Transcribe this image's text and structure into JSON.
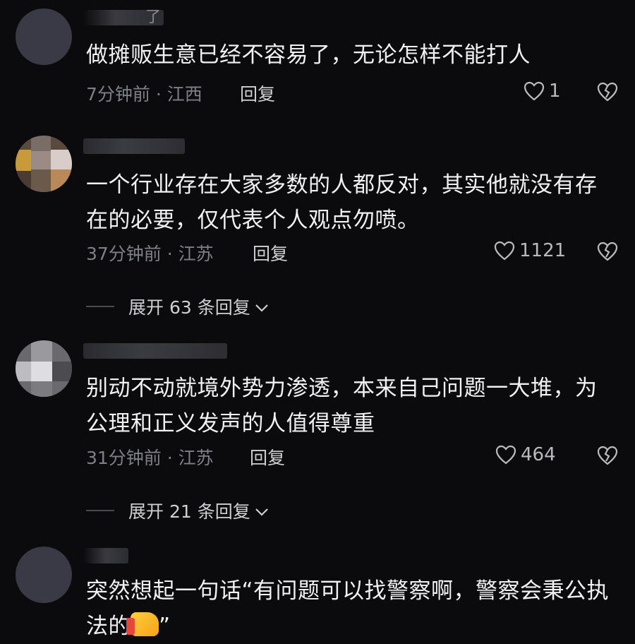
{
  "comments": [
    {
      "username_fragment": "了",
      "text": "做摊贩生意已经不容易了，无论怎样不能打人",
      "meta": "7分钟前 · 江西",
      "reply_label": "回复",
      "likes": "1"
    },
    {
      "username_fragment": "",
      "text": "一个行业存在大家多数的人都反对，其实他就没有存在的必要，仅代表个人观点勿喷。",
      "meta": "37分钟前 · 江苏",
      "reply_label": "回复",
      "likes": "1121",
      "expand_label": "展开 63 条回复"
    },
    {
      "username_fragment": "",
      "text": "别动不动就境外势力渗透，本来自己问题一大堆，为公理和正义发声的人值得尊重",
      "meta": "31分钟前 · 江苏",
      "reply_label": "回复",
      "likes": "464",
      "expand_label": "展开 21 条回复"
    },
    {
      "username_fragment": "",
      "text": "突然想起一句话“有问题可以找警察啊，警察会秉公执法的",
      "text_suffix": "”",
      "emoji": "thumbs-up-emoji"
    }
  ],
  "icons": {
    "like": "heart-outline-icon",
    "dislike": "broken-heart-icon",
    "expand": "chevron-down-icon"
  },
  "colors": {
    "background": "#0b0b0d",
    "text": "#f1f1f4",
    "meta": "#7f7f86"
  }
}
